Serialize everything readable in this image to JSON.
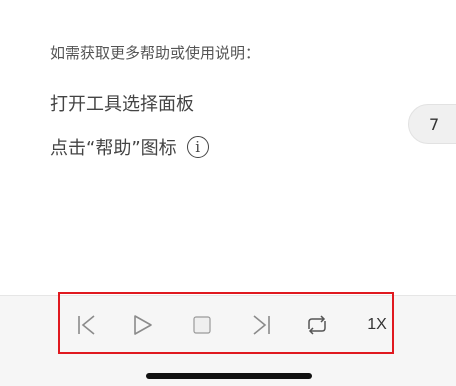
{
  "help": {
    "line1": "如需获取更多帮助或使用说明：",
    "line2": "打开工具选择面板",
    "line3": "点击“帮助”图标"
  },
  "page_tab": {
    "number": "7"
  },
  "player": {
    "speed_label": "1X",
    "icons": [
      "skip-back-icon",
      "play-icon",
      "stop-icon",
      "skip-forward-icon",
      "loop-icon"
    ]
  },
  "colors": {
    "highlight_border": "#e0191f",
    "icon_gray": "#8b8b8b"
  }
}
